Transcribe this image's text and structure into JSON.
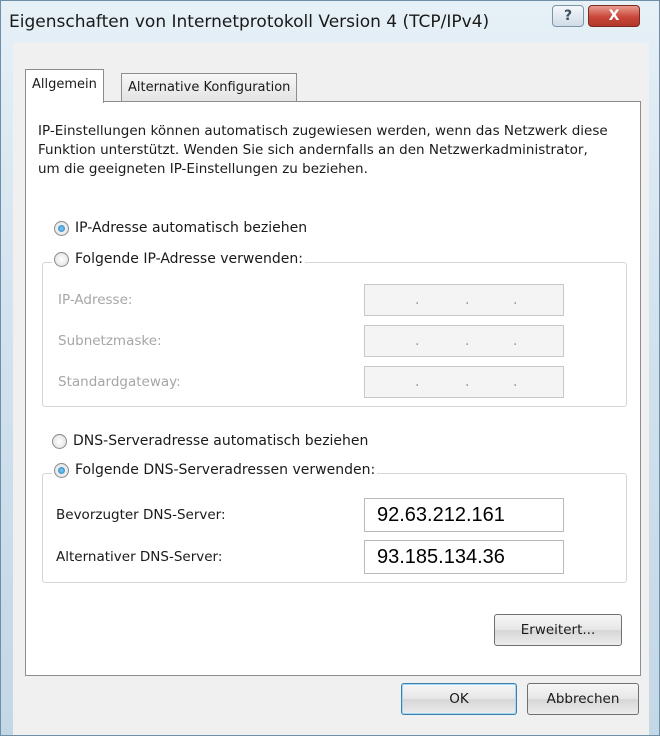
{
  "window": {
    "title": "Eigenschaften von Internetprotokoll Version 4 (TCP/IPv4)",
    "help_glyph": "?",
    "close_glyph": "X"
  },
  "tabs": [
    {
      "label": "Allgemein",
      "active": true
    },
    {
      "label": "Alternative Konfiguration",
      "active": false
    }
  ],
  "general": {
    "description": "IP-Einstellungen können automatisch zugewiesen werden, wenn das Netzwerk diese Funktion unterstützt. Wenden Sie sich andernfalls an den Netzwerkadministrator, um die geeigneten IP-Einstellungen zu beziehen.",
    "ip_auto_label": "IP-Adresse automatisch beziehen",
    "ip_manual_label": "Folgende IP-Adresse verwenden:",
    "ip_mode": "auto",
    "ip_fields": [
      {
        "label": "IP-Adresse:",
        "value": ""
      },
      {
        "label": "Subnetzmaske:",
        "value": ""
      },
      {
        "label": "Standardgateway:",
        "value": ""
      }
    ],
    "ip_dot": ".",
    "dns_auto_label": "DNS-Serveradresse automatisch beziehen",
    "dns_manual_label": "Folgende DNS-Serveradressen verwenden:",
    "dns_mode": "manual",
    "preferred_dns_label": "Bevorzugter DNS-Server:",
    "preferred_dns_value": "92.63.212.161",
    "alternate_dns_label": "Alternativer DNS-Server:",
    "alternate_dns_value": "93.185.134.36",
    "advanced_button": "Erweitert..."
  },
  "footer": {
    "ok_button": "OK",
    "cancel_button": "Abbrechen"
  }
}
